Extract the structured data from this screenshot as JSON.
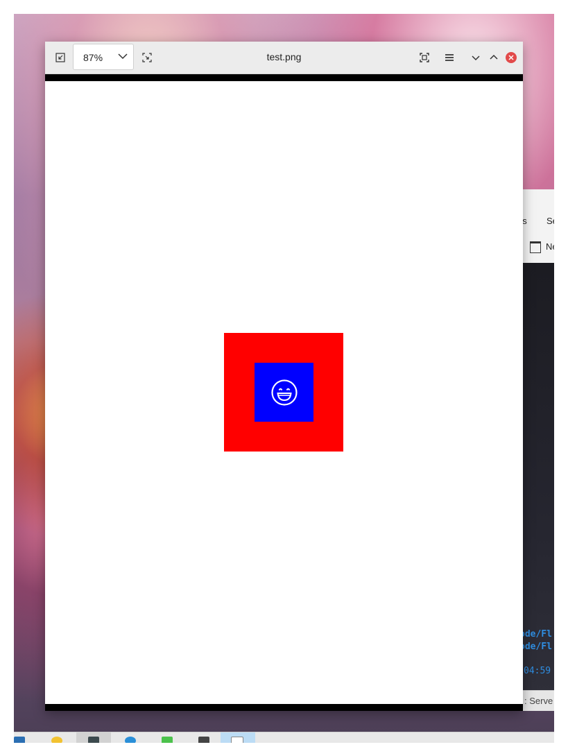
{
  "viewer": {
    "zoom": "87%",
    "title": "test.png",
    "image": {
      "outer_color": "#ff0000",
      "inner_color": "#0000ff",
      "glyph": "grinning-face-icon",
      "glyph_color": "#ffffff"
    },
    "toolbar": {
      "left_icons": [
        "shrink-to-fit-icon",
        "zoom-dropdown",
        "fit-selection-icon"
      ],
      "right_icons": [
        "fullscreen-icon",
        "hamburger-menu-icon",
        "minimize-icon",
        "maximize-icon",
        "close-icon"
      ]
    }
  },
  "background_app": {
    "menu_items": [
      "ns",
      "Se"
    ],
    "toolbar_label": "Ne",
    "terminal_lines": [
      "ode/Fl",
      "ode/Fl"
    ],
    "terminal_time": "04:59",
    "status": ": Serve"
  },
  "taskbar": {
    "apps": [
      "file-manager-icon",
      "star-app-icon",
      "terminal-icon",
      "browser-icon",
      "chat-icon",
      "monitor-icon",
      "image-viewer-icon"
    ]
  }
}
